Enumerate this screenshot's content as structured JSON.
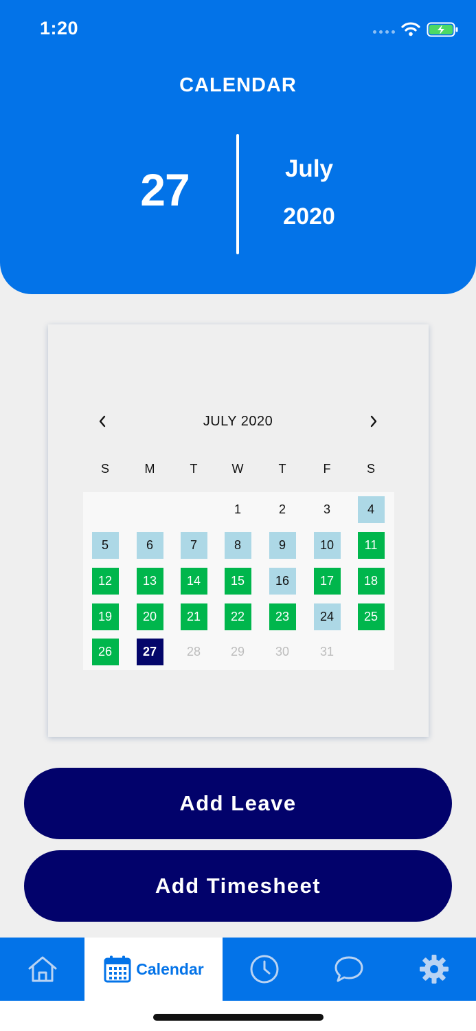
{
  "status_bar": {
    "time": "1:20"
  },
  "header": {
    "title": "CALENDAR",
    "day": "27",
    "month": "July",
    "year": "2020"
  },
  "calendar": {
    "month_label": "JULY 2020",
    "weekdays": [
      "S",
      "M",
      "T",
      "W",
      "T",
      "F",
      "S"
    ],
    "days": [
      {
        "label": "1",
        "state": "plain"
      },
      {
        "label": "2",
        "state": "plain"
      },
      {
        "label": "3",
        "state": "plain"
      },
      {
        "label": "4",
        "state": "past"
      },
      {
        "label": "5",
        "state": "past"
      },
      {
        "label": "6",
        "state": "past"
      },
      {
        "label": "7",
        "state": "past"
      },
      {
        "label": "8",
        "state": "past"
      },
      {
        "label": "9",
        "state": "past"
      },
      {
        "label": "10",
        "state": "past"
      },
      {
        "label": "11",
        "state": "green"
      },
      {
        "label": "12",
        "state": "green"
      },
      {
        "label": "13",
        "state": "green"
      },
      {
        "label": "14",
        "state": "green"
      },
      {
        "label": "15",
        "state": "green"
      },
      {
        "label": "16",
        "state": "past"
      },
      {
        "label": "17",
        "state": "green"
      },
      {
        "label": "18",
        "state": "green"
      },
      {
        "label": "19",
        "state": "green"
      },
      {
        "label": "20",
        "state": "green"
      },
      {
        "label": "21",
        "state": "green"
      },
      {
        "label": "22",
        "state": "green"
      },
      {
        "label": "23",
        "state": "green"
      },
      {
        "label": "24",
        "state": "past"
      },
      {
        "label": "25",
        "state": "green"
      },
      {
        "label": "26",
        "state": "green"
      },
      {
        "label": "27",
        "state": "today"
      },
      {
        "label": "28",
        "state": "future"
      },
      {
        "label": "29",
        "state": "future"
      },
      {
        "label": "30",
        "state": "future"
      },
      {
        "label": "31",
        "state": "future"
      }
    ]
  },
  "actions": {
    "add_leave": "Add Leave",
    "add_timesheet": "Add Timesheet"
  },
  "tabbar": {
    "calendar_label": "Calendar",
    "icons": [
      "home-icon",
      "calendar-icon",
      "clock-icon",
      "chat-icon",
      "gear-icon"
    ]
  },
  "colors": {
    "primary": "#0373e8",
    "navy": "#02026b",
    "green": "#00b64c",
    "light_blue": "#add8e6",
    "today": "#04066a",
    "disabled": "#bdbdbd"
  }
}
